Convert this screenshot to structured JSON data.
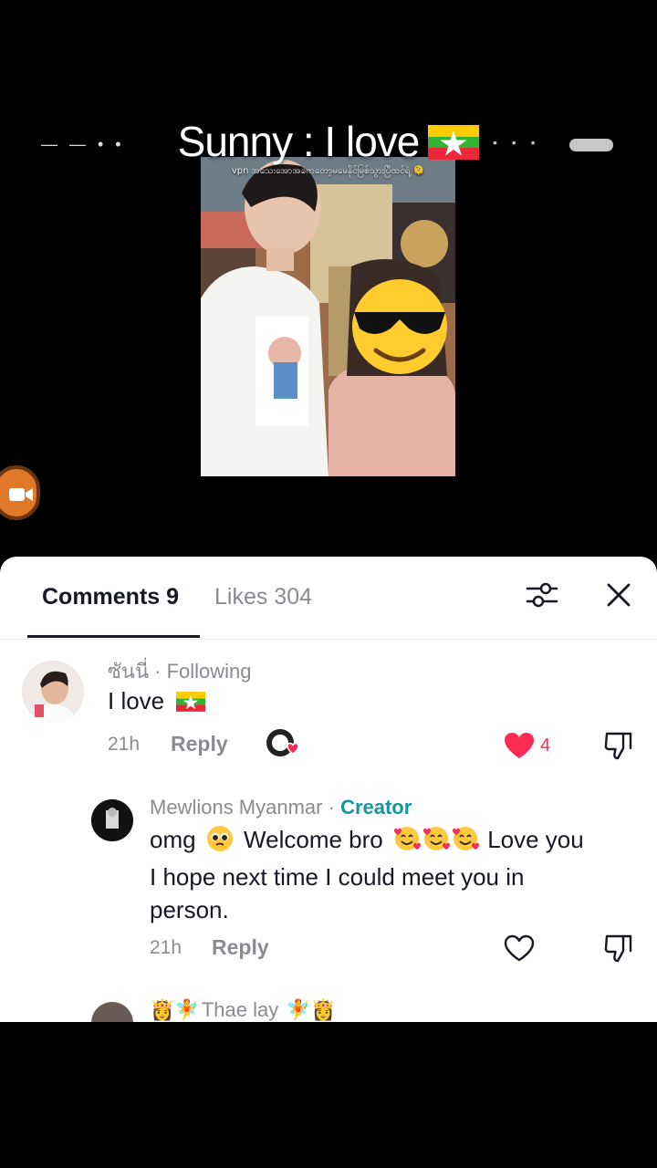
{
  "video": {
    "title": "Sunny : I love",
    "title_flag": "myanmar-flag",
    "caption": "vpn အသေးအောအခကတော့မမေနိုင်မြစ်သွားပြီထင်ရဲ့ 🫠",
    "faint_left": "— — • •",
    "faint_right": "• • •"
  },
  "tabs": {
    "comments": "Comments 9",
    "likes": "Likes 304"
  },
  "comments": [
    {
      "username": "ซันนี่",
      "sep": " · ",
      "status": "Following",
      "text": "I love",
      "time": "21h",
      "reply": "Reply",
      "likes": "4"
    },
    {
      "username": "Mewlions Myanmar",
      "sep": " · ",
      "status": "Creator",
      "text_a": "omg",
      "text_b": "Welcome bro",
      "text_c": "Love you",
      "text_d": "I hope next time I could meet you in",
      "text_e": "person.",
      "time": "21h",
      "reply": "Reply"
    },
    {
      "username": "Thae lay"
    }
  ],
  "colors": {
    "accent_like": "#fe2c55",
    "creator": "#15969c",
    "muted": "#8a8b91"
  }
}
